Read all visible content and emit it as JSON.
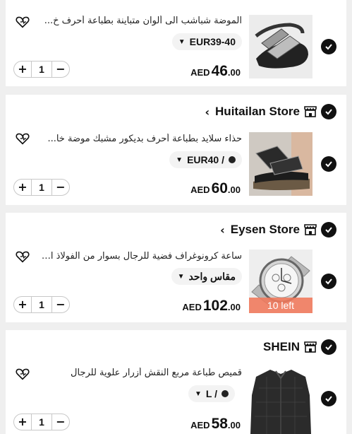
{
  "colors": {
    "background": "#efefef",
    "card": "#ffffff",
    "check": "#111111",
    "badge": "#f0785a"
  },
  "items": [
    {
      "store": null,
      "title": "الموضة شباشب الى ألوان متباينة بطباعة أحرف خ...",
      "variant": "EUR39-40",
      "variant_has_dot": false,
      "quantity": "1",
      "currency": "AED",
      "price_int": "46",
      "price_dec": ".00",
      "stock_badge": null,
      "icon": "slipper-image"
    },
    {
      "store": "Huitailan Store",
      "title": "حذاء سلايد بطباعة أحرف بديكور مشبك موضة خا...",
      "variant": "EUR40 /",
      "variant_has_dot": true,
      "quantity": "1",
      "currency": "AED",
      "price_int": "60",
      "price_dec": ".00",
      "stock_badge": null,
      "icon": "sandal-image"
    },
    {
      "store": "Eysen Store",
      "title": "ساعة كرونوغراف فضية للرجال بسوار من الفولاذ ال...",
      "variant": "مقاس واحد",
      "variant_has_dot": false,
      "quantity": "1",
      "currency": "AED",
      "price_int": "102",
      "price_dec": ".00",
      "stock_badge": "10 left",
      "icon": "watch-image"
    },
    {
      "store": "SHEIN",
      "title": "قميص طباعة مربع النقش أزرار علوية للرجال",
      "variant": "L /",
      "variant_has_dot": true,
      "quantity": "1",
      "currency": "AED",
      "price_int": "58",
      "price_dec": ".00",
      "stock_badge": null,
      "icon": "shirt-image"
    }
  ],
  "stepper": {
    "minus": "−",
    "plus": "+"
  }
}
